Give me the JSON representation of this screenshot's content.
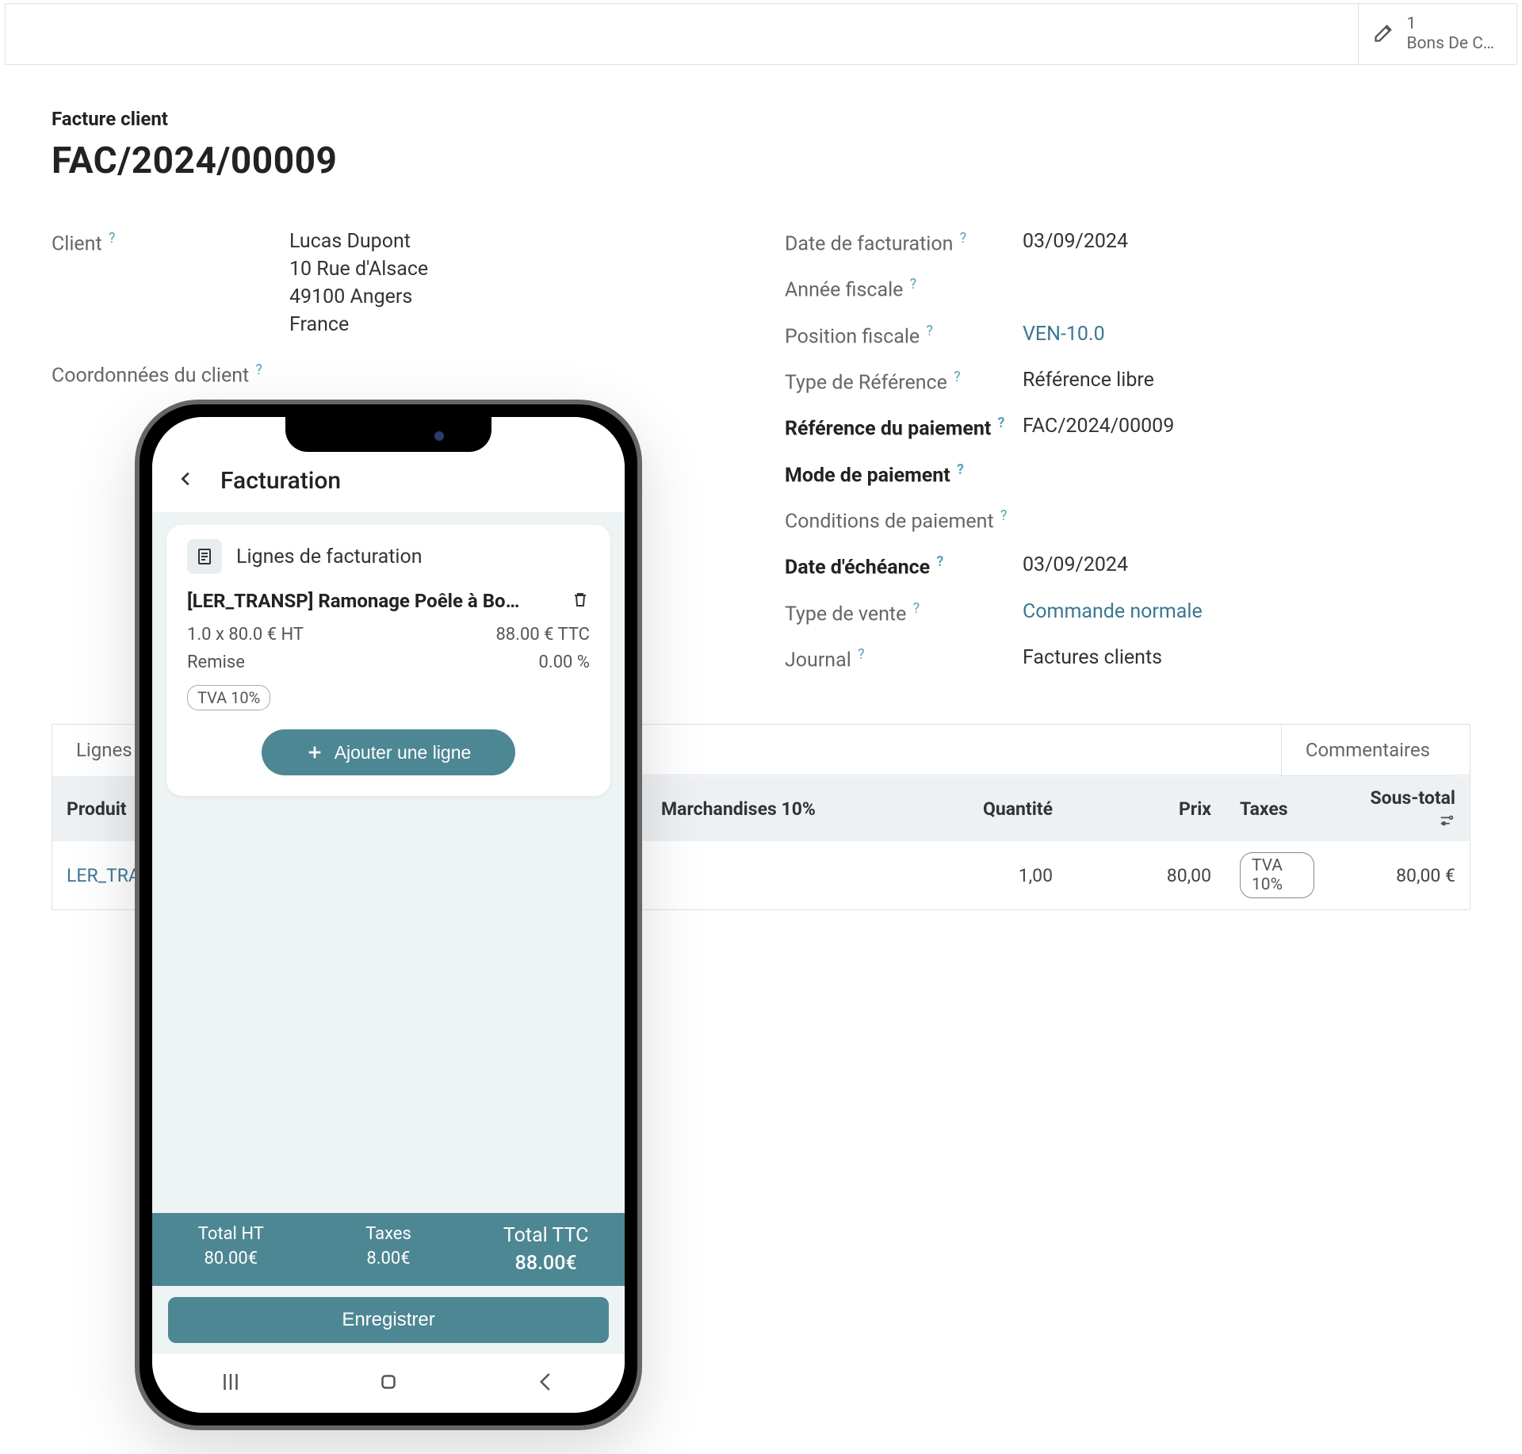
{
  "topbar": {
    "count": "1",
    "label": "Bons De C…"
  },
  "doc": {
    "subtitle": "Facture client",
    "title": "FAC/2024/00009"
  },
  "left": {
    "client_label": "Client",
    "client_name": "Lucas Dupont",
    "client_addr1": "10 Rue d'Alsace",
    "client_addr2": "49100 Angers",
    "client_addr3": "France",
    "coords_label": "Coordonnées du client"
  },
  "right": {
    "invoice_date_label": "Date de facturation",
    "invoice_date": "03/09/2024",
    "fiscal_year_label": "Année fiscale",
    "fiscal_pos_label": "Position fiscale",
    "fiscal_pos": "VEN-10.0",
    "ref_type_label": "Type de Référence",
    "ref_type": "Référence libre",
    "pay_ref_label": "Référence du paiement",
    "pay_ref": "FAC/2024/00009",
    "pay_mode_label": "Mode de paiement",
    "pay_cond_label": "Conditions de paiement",
    "due_date_label": "Date d'échéance",
    "due_date": "03/09/2024",
    "sale_type_label": "Type de vente",
    "sale_type": "Commande normale",
    "journal_label": "Journal",
    "journal": "Factures clients"
  },
  "tabs": {
    "lines": "Lignes",
    "comments": "Commentaires"
  },
  "table": {
    "h_product": "Produit",
    "h_something": "",
    "h_tax10": "Marchandises 10%",
    "h_qty": "Quantité",
    "h_price": "Prix",
    "h_taxes": "Taxes",
    "h_subtotal": "Sous-total",
    "r_product": "LER_TRA",
    "r_qty": "1,00",
    "r_price": "80,00",
    "r_tax": "TVA 10%",
    "r_subtotal": "80,00 €"
  },
  "phone": {
    "screen_title": "Facturation",
    "card_title": "Lignes de facturation",
    "line_title": "[LER_TRANSP] Ramonage Poêle à Bo…",
    "qty_price": "1.0 x 80.0 € HT",
    "total_ttc": "88.00 € TTC",
    "discount_label": "Remise",
    "discount_val": "0.00 %",
    "tax_chip": "TVA 10%",
    "add_line": "Ajouter une ligne",
    "totals": {
      "ht_label": "Total HT",
      "ht_val": "80.00€",
      "tax_label": "Taxes",
      "tax_val": "8.00€",
      "ttc_label": "Total TTC",
      "ttc_val": "88.00€"
    },
    "save": "Enregistrer"
  }
}
